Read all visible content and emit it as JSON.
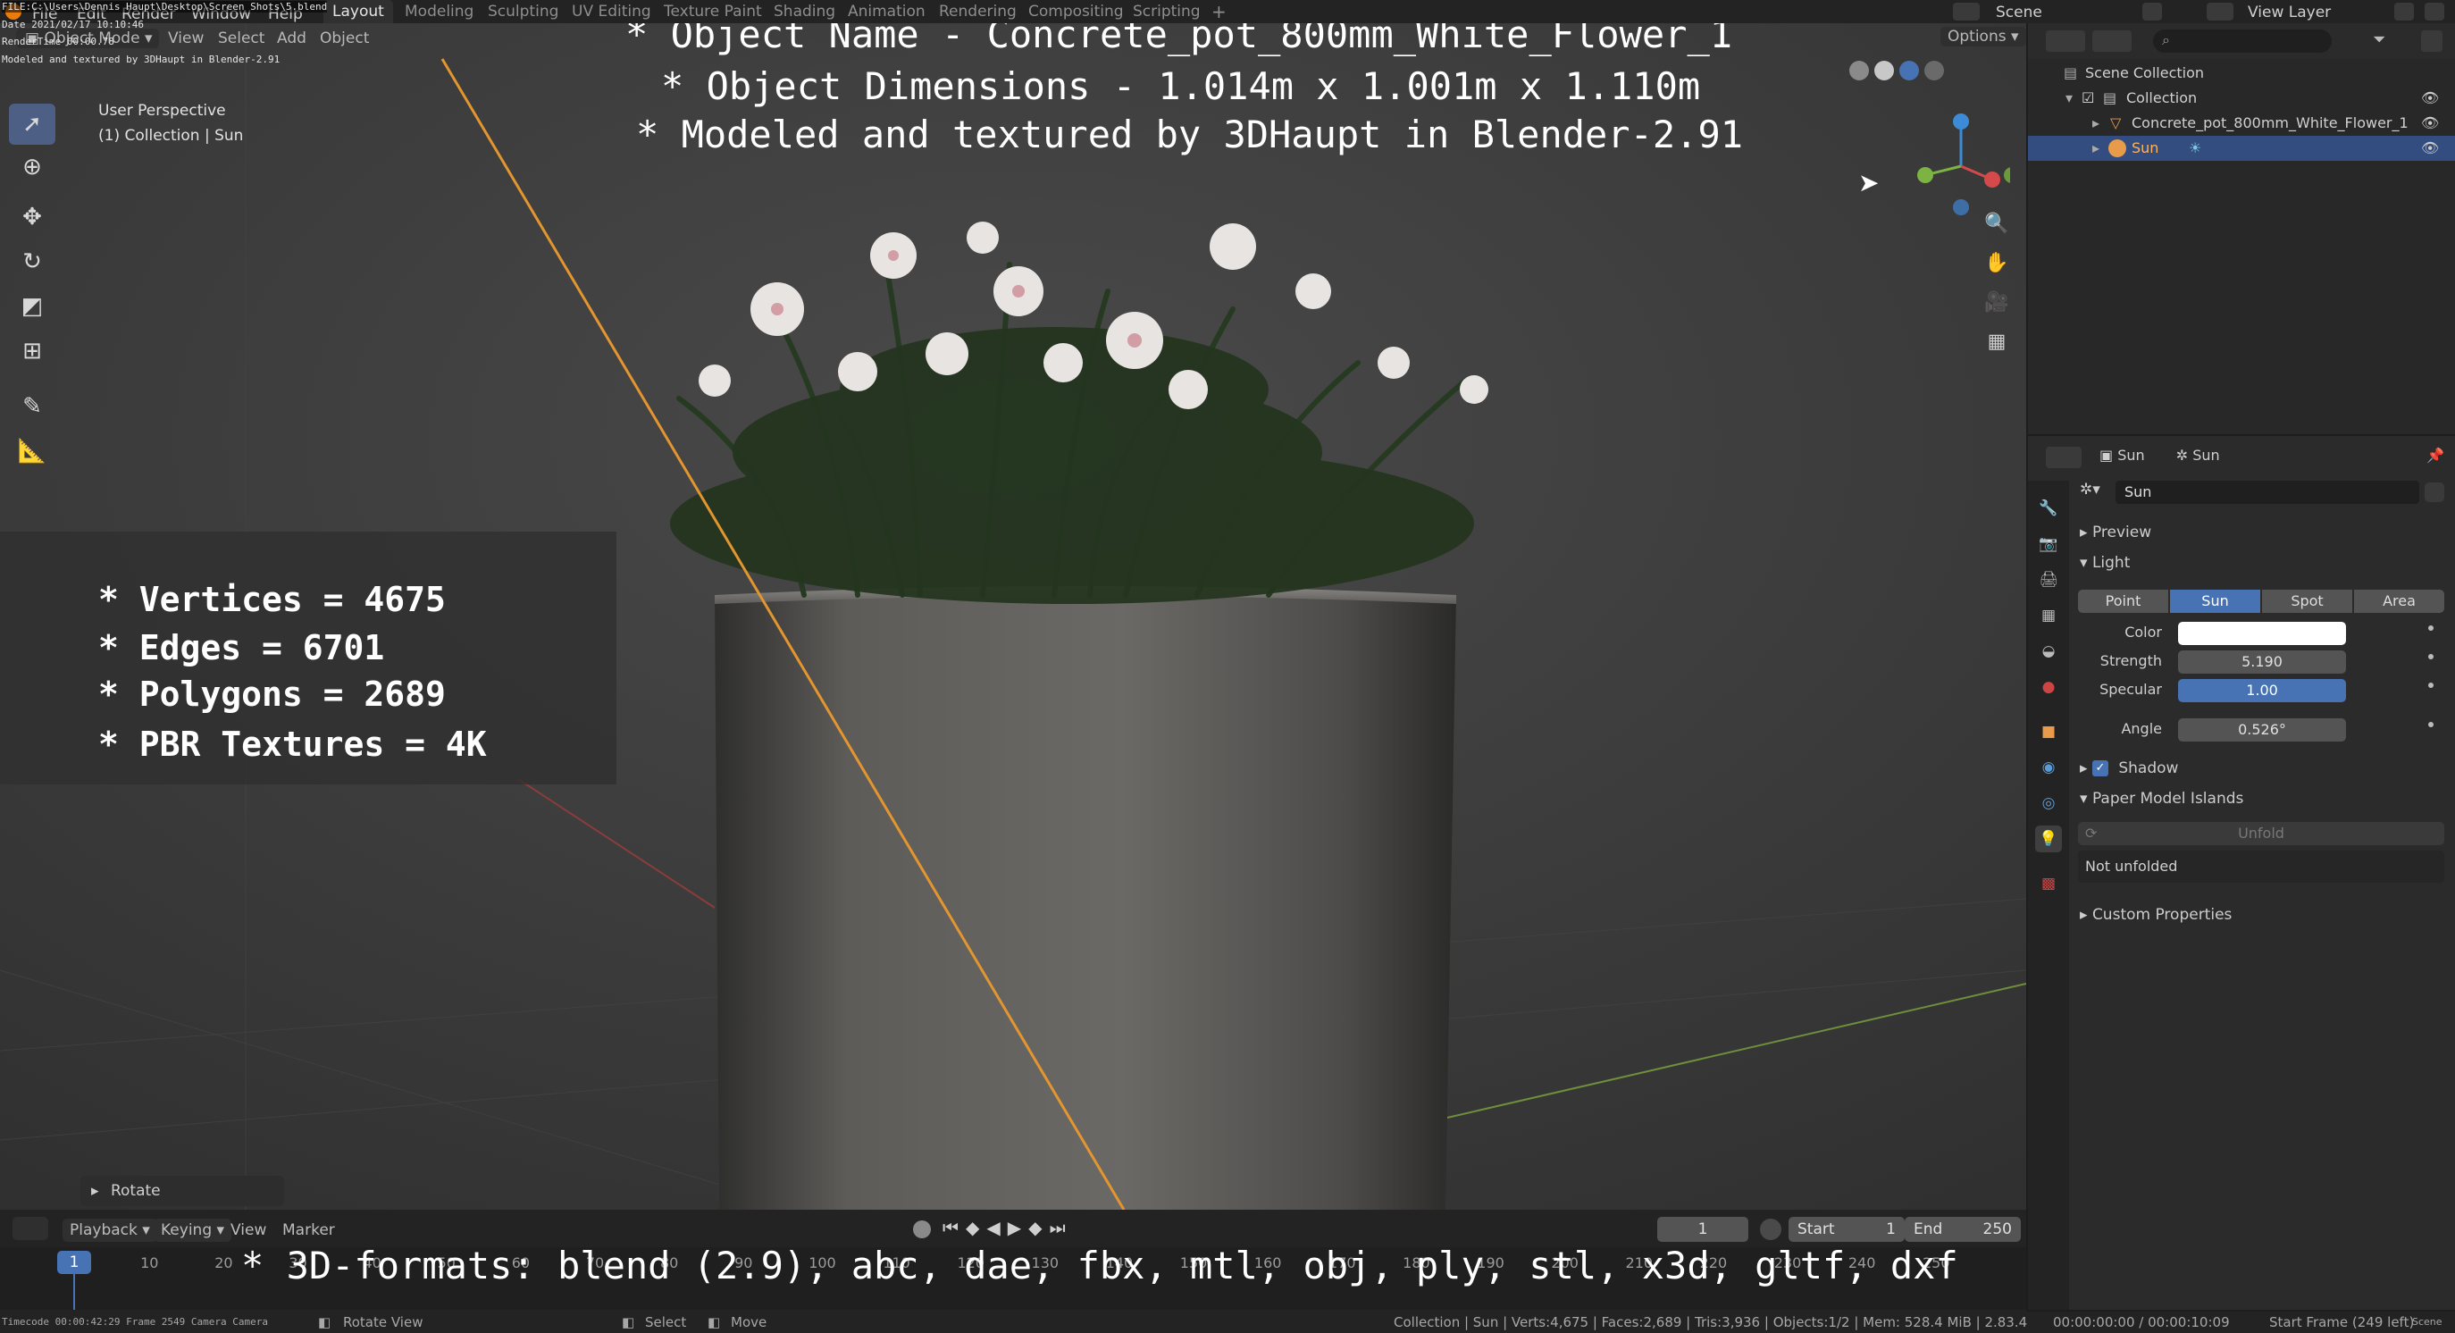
{
  "top_bar": {
    "file_path": "FILE:C:\\Users\\Dennis Haupt\\Desktop\\Screen Shots\\5.blend",
    "date": "Date 2021/02/17 10:10:46",
    "render_time": "RenderTime 00:00.78",
    "modeled_by": "Modeled and textured by 3DHaupt in Blender-2.91",
    "workspace_tabs": [
      "Layout",
      "Modeling",
      "Sculpting",
      "UV Editing",
      "Texture Paint",
      "Shading",
      "Animation",
      "Rendering",
      "Compositing",
      "Scripting"
    ],
    "add_tab": "+",
    "scene_label": "Scene",
    "view_layer_label": "View Layer"
  },
  "viewport": {
    "mode": "Object Mode",
    "menus": [
      "View",
      "Select",
      "Add",
      "Object"
    ],
    "options_label": "Options",
    "perspective_label": "User Perspective",
    "collection_label": "(1) Collection | Sun",
    "overlay_lines": [
      "* Object Name - Concrete_pot_800mm_White_Flower_1",
      "* Object Dimensions -  1.014m x 1.001m x 1.110m",
      "* Modeled and textured by 3DHaupt in Blender-2.91"
    ],
    "stats_lines": [
      "* Vertices = 4675",
      "* Edges = 6701",
      "* Polygons = 2689",
      "* PBR Textures = 4K"
    ],
    "operator_panel": "Rotate",
    "gizmo_axes": {
      "x": "X",
      "y": "Y",
      "z": "Z"
    },
    "colors": {
      "x_axis": "#d44a4a",
      "y_axis": "#7cb342",
      "z_axis": "#3d8bd6",
      "sun_line": "#e3962f",
      "select_blue": "#4772b3"
    }
  },
  "timeline": {
    "menus": [
      "Playback",
      "Keying",
      "View",
      "Marker"
    ],
    "current_frame": "1",
    "start_label": "Start",
    "start_value": "1",
    "end_label": "End",
    "end_value": "250",
    "ruler_numbers": [
      "10",
      "20",
      "30",
      "40",
      "50",
      "60",
      "70",
      "80",
      "90",
      "100",
      "110",
      "120",
      "130",
      "140",
      "150",
      "160",
      "170",
      "180",
      "190",
      "200",
      "210",
      "220",
      "230",
      "240",
      "250"
    ],
    "playhead": "1",
    "formats_overlay": "* 3D-formats: blend (2.9), abc, dae, fbx, mtl, obj, ply, stl, x3d, gltf, dxf"
  },
  "status_bar": {
    "timecode": "Timecode 00:00:42:29 Frame 2549 Camera Camera",
    "select_hint": "Select",
    "move_hint": "Move",
    "rotate_view_hint": "Rotate View",
    "stats": "Collection | Sun | Verts:4,675 | Faces:2,689 | Tris:3,936 | Objects:1/2 | Mem: 528.4 MiB | 2.83.4",
    "frame_info": "00:00:00:00 / 00:00:10:09",
    "start_frame_info": "Start Frame (249 left)",
    "scene_right": "Scene"
  },
  "outliner": {
    "scene_collection": "Scene Collection",
    "collection": "Collection",
    "object": "Concrete_pot_800mm_White_Flower_1",
    "sun": "Sun"
  },
  "properties": {
    "breadcrumb_object": "Sun",
    "breadcrumb_data": "Sun",
    "datablock_name": "Sun",
    "panels": {
      "preview": "Preview",
      "light": "Light",
      "shadow": "Shadow",
      "paper_model": "Paper Model Islands",
      "custom_props": "Custom Properties"
    },
    "light_types": [
      "Point",
      "Sun",
      "Spot",
      "Area"
    ],
    "active_light_type": "Sun",
    "color_label": "Color",
    "strength_label": "Strength",
    "strength_value": "5.190",
    "specular_label": "Specular",
    "specular_value": "1.00",
    "angle_label": "Angle",
    "angle_value": "0.526°",
    "unfold_label": "Unfold",
    "not_unfolded": "Not unfolded"
  }
}
